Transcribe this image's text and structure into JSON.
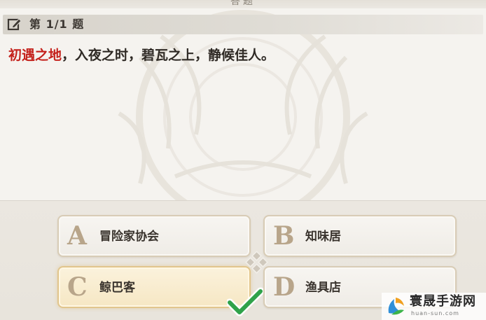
{
  "window": {
    "title": "答题"
  },
  "question": {
    "number_label": "第 1/1 题",
    "highlight": "初遇之地",
    "text": "，入夜之时，碧瓦之上，静候佳人。"
  },
  "options": [
    {
      "letter": "A",
      "label": "冒险家协会",
      "selected": false
    },
    {
      "letter": "B",
      "label": "知味居",
      "selected": false
    },
    {
      "letter": "C",
      "label": "鲸巴客",
      "selected": true
    },
    {
      "letter": "D",
      "label": "渔具店",
      "selected": false
    }
  ],
  "icons": {
    "edit": "edit-icon",
    "confirm": "check-mark-icon",
    "divider": "diamond-ornament-icon"
  },
  "watermark": {
    "name": "寰晟手游网",
    "url": "huan-sun.com"
  },
  "colors": {
    "highlight_red": "#c4221c",
    "selected_bg": "#f6e7c4",
    "check_green": "#2fa24a",
    "option_letter": "#b8a58a"
  }
}
